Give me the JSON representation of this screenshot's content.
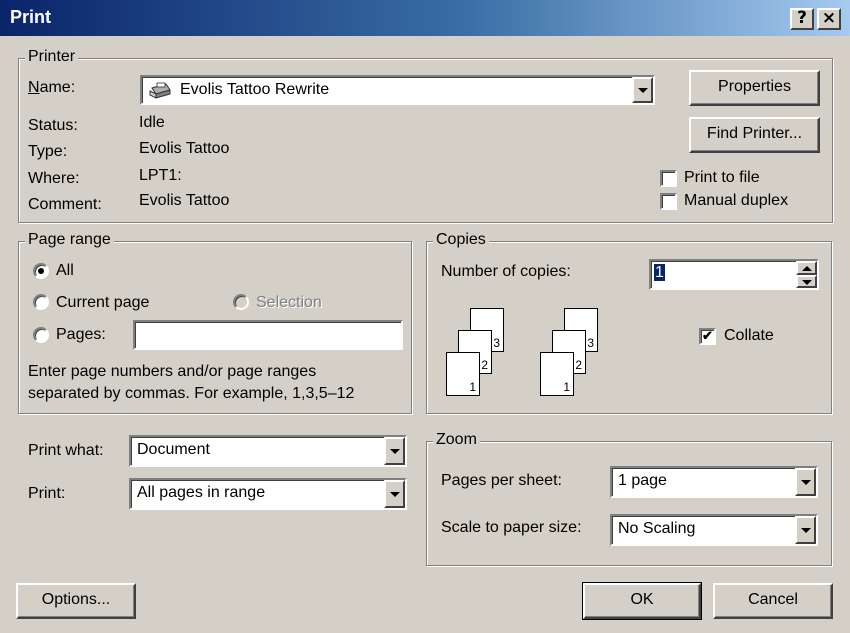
{
  "window": {
    "title": "Print",
    "help_label": "?",
    "close_label": "×"
  },
  "printer": {
    "group_label": "Printer",
    "name_label": "Name:",
    "name_value": "Evolis Tattoo Rewrite",
    "status_label": "Status:",
    "status_value": "Idle",
    "type_label": "Type:",
    "type_value": "Evolis Tattoo",
    "where_label": "Where:",
    "where_value": "LPT1:",
    "comment_label": "Comment:",
    "comment_value": "Evolis Tattoo",
    "properties_button": "Properties",
    "find_printer_button": "Find Printer...",
    "print_to_file_label": "Print to file",
    "print_to_file_checked": false,
    "manual_duplex_label": "Manual duplex",
    "manual_duplex_checked": false
  },
  "page_range": {
    "group_label": "Page range",
    "all_label": "All",
    "current_page_label": "Current page",
    "selection_label": "Selection",
    "pages_label": "Pages:",
    "pages_value": "",
    "selected": "all",
    "hint_line1": "Enter page numbers and/or page ranges",
    "hint_line2": "separated by commas.  For example, 1,3,5–12"
  },
  "copies": {
    "group_label": "Copies",
    "number_label": "Number of copies:",
    "number_value": "1",
    "collate_label": "Collate",
    "collate_checked": true,
    "page_numbers": [
      "1",
      "2",
      "3"
    ]
  },
  "print_what": {
    "label": "Print what:",
    "value": "Document"
  },
  "print": {
    "label": "Print:",
    "value": "All pages in range"
  },
  "zoom": {
    "group_label": "Zoom",
    "pages_per_sheet_label": "Pages per sheet:",
    "pages_per_sheet_value": "1 page",
    "scale_label": "Scale to paper size:",
    "scale_value": "No Scaling"
  },
  "buttons": {
    "options": "Options...",
    "ok": "OK",
    "cancel": "Cancel"
  },
  "colors": {
    "face": "#d4d0c8",
    "titlebar_start": "#0a246a",
    "titlebar_end": "#a6caf0",
    "highlight": "#0a246a"
  }
}
